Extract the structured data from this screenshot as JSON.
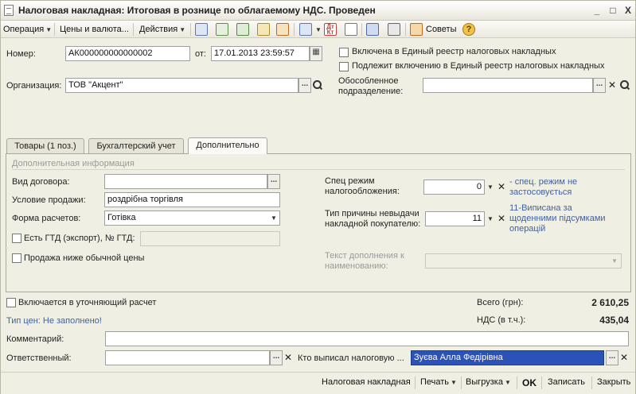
{
  "window": {
    "title": "Налоговая накладная: Итоговая в рознице по облагаемому НДС. Проведен",
    "minimize": "_",
    "maximize": "□",
    "close": "X"
  },
  "toolbar": {
    "operation": "Операция",
    "prices": "Цены и валюта...",
    "actions": "Действия",
    "tips": "Советы"
  },
  "header": {
    "number_label": "Номер:",
    "number_value": "АК000000000000002",
    "from_label": "от:",
    "date_value": "17.01.2013 23:59:57",
    "included_unified": "Включена в Единый реестр налоговых накладных",
    "subject_unified": "Подлежит включению в Единый реестр налоговых накладных",
    "org_label": "Организация:",
    "org_value": "ТОВ \"Акцент\"",
    "subdiv_label_1": "Обособленное",
    "subdiv_label_2": "подразделение:",
    "subdiv_value": ""
  },
  "tabs": [
    {
      "label": "Товары (1 поз.)"
    },
    {
      "label": "Бухгалтерский учет"
    },
    {
      "label": "Дополнительно"
    }
  ],
  "extra": {
    "section_title": "Дополнительная информация",
    "contract_label": "Вид договора:",
    "contract_value": "",
    "sale_cond_label": "Условие продажи:",
    "sale_cond_value": "роздрібна торгівля",
    "payment_form_label": "Форма расчетов:",
    "payment_form_value": "Готівка",
    "gtd_label": "Есть ГТД (экспорт), № ГТД:",
    "gtd_value": "",
    "below_price_label": "Продажа ниже обычной цены",
    "tax_mode_label_1": "Спец режим",
    "tax_mode_label_2": "налогообложения:",
    "tax_mode_value": "0",
    "tax_mode_link_1": "- спец. режим не",
    "tax_mode_link_2": "застосовується",
    "reason_label_1": "Тип причины невыдачи",
    "reason_label_2": "накладной покупателю:",
    "reason_value": "11",
    "reason_link_1": "11-Виписана за",
    "reason_link_2": "щоденними підсумками",
    "reason_link_3": "операцій",
    "addon_text_label_1": "Текст дополнения к",
    "addon_text_label_2": "наименованию:",
    "addon_text_value": ""
  },
  "footer": {
    "refine_label": "Включается в уточняющий расчет",
    "total_label": "Всего (грн):",
    "total_value": "2 610,25",
    "price_type_link": "Тип цен: Не заполнено!",
    "vat_label": "НДС (в т.ч.):",
    "vat_value": "435,04",
    "comment_label": "Комментарий:",
    "comment_value": "",
    "responsible_label": "Ответственный:",
    "responsible_value": "",
    "issuer_label": "Кто выписал налоговую ...",
    "issuer_value": "Зуєва Алла Федірівна"
  },
  "bottom": {
    "tax_invoice": "Налоговая накладная",
    "print": "Печать",
    "upload": "Выгрузка",
    "ok": "OK",
    "save": "Записать",
    "close": "Закрыть"
  }
}
